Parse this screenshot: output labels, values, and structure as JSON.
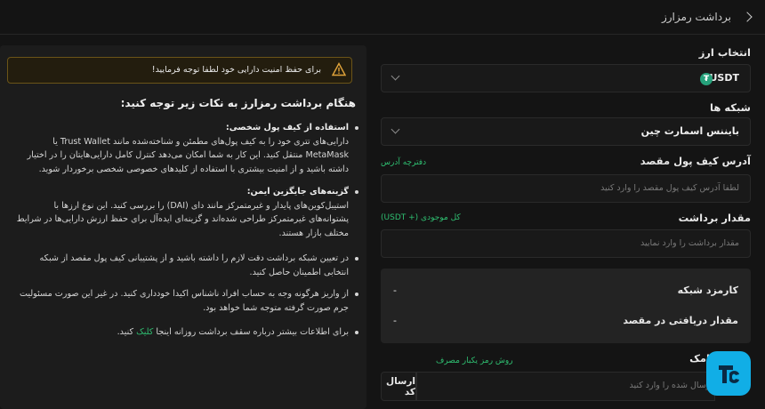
{
  "header": {
    "title": "برداشت رمزارز"
  },
  "form": {
    "currency_label": "انتخاب ارز",
    "currency_value": "USDT",
    "network_label": "شبکه ها",
    "network_value": "بایننس اسمارت چین",
    "address_label": "آدرس کیف پول مقصد",
    "address_book": "دفترچه آدرس",
    "address_placeholder": "لطفا آدرس کیف پول مقصد را وارد کنید",
    "amount_label": "مقدار برداشت",
    "balance_text": "کل موجودی (+ USDT)",
    "amount_placeholder": "مقدار برداشت را وارد نمایید",
    "fee_label": "کارمزد شبکه",
    "fee_value": "-",
    "receive_label": "مقدار دریافتی در مقصد",
    "receive_value": "-",
    "code_label": "امک",
    "otp_link": "روش رمز یکبار مصرف",
    "code_placeholder": "ارسال شده را وارد کنید",
    "send_label": "ارسال کد"
  },
  "panel": {
    "warning": "برای حفظ امنیت دارایی خود لطفا توجه فرمایید!",
    "heading": "هنگام برداشت رمزارز به نکات زیر توجه کنید:",
    "notes": [
      {
        "title": "استفاده از کیف پول شخصی:",
        "text": "دارایی‌های تتری خود را به کیف پول‌های مطمئن و شناخته‌شده مانند Trust Wallet یا MetaMask منتقل کنید. این کار به شما امکان می‌دهد کنترل کامل دارایی‌هایتان را در اختیار داشته باشید و از امنیت بیشتری با استفاده از کلیدهای خصوصی شخصی برخوردار شوید."
      },
      {
        "title": "گزینه‌های جایگزین ایمن:",
        "text": "استیبل‌کوین‌های پایدار و غیرمتمرکز مانند دای (DAI) را بررسی کنید. این نوع ارزها با پشتوانه‌های غیرمتمرکز طراحی شده‌اند و گزینه‌ای ایده‌آل برای حفظ ارزش دارایی‌ها در شرایط مختلف بازار هستند."
      },
      {
        "title": "",
        "text": "در تعیین شبکه برداشت دقت لازم را داشته باشید و از پشتیبانی کیف پول مقصد از شبکه انتخابی اطمینان حاصل کنید."
      },
      {
        "title": "",
        "text": "از واریز هرگونه وجه به حساب افراد ناشناس اکیدا خودداری کنید. در غیر این صورت مسئولیت جرم صورت گرفته متوجه شما خواهد بود."
      }
    ],
    "last_note_prefix": "برای اطلاعات بیشتر درباره سقف برداشت روزانه اینجا",
    "last_note_link": "کلیک",
    "last_note_suffix": "کنید."
  }
}
